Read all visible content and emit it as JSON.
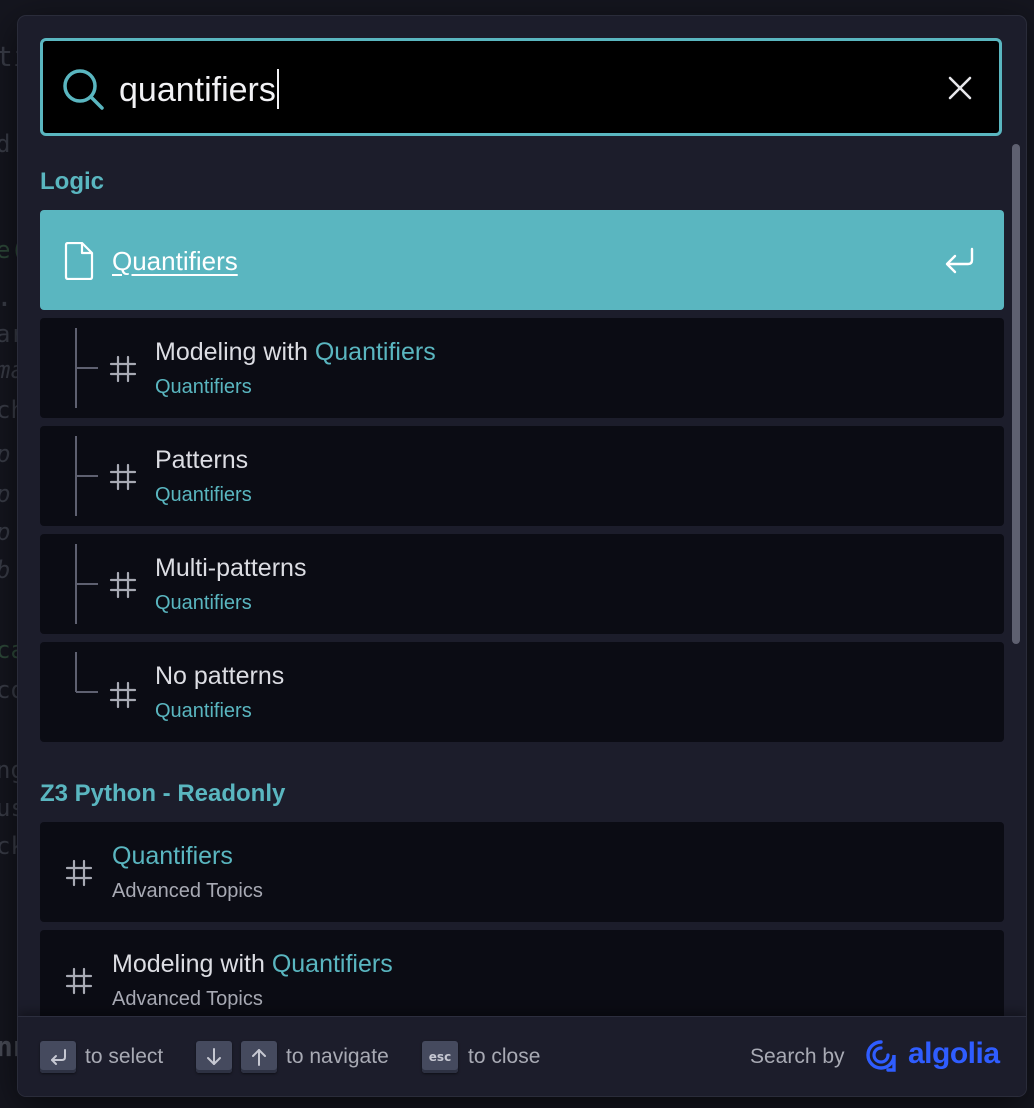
{
  "background": {
    "fragments": [
      "ti",
      "d",
      "e(",
      "..",
      "ar",
      "ma",
      "ch",
      "p",
      "p",
      "p",
      "b",
      "ca",
      "co",
      "ng",
      "us",
      "ck",
      "nn"
    ]
  },
  "search": {
    "query": "quantifiers",
    "clear_icon": "close-icon"
  },
  "sections": [
    {
      "title": "Logic",
      "hits": [
        {
          "title": "Quantifiers",
          "selected": true,
          "icon": "document-icon"
        },
        {
          "title_prefix": "Modeling with ",
          "title_highlight": "Quantifiers",
          "subtitle": "Quantifiers"
        },
        {
          "title_prefix": "Patterns",
          "title_highlight": "",
          "subtitle": "Quantifiers"
        },
        {
          "title_prefix": "Multi-patterns",
          "title_highlight": "",
          "subtitle": "Quantifiers"
        },
        {
          "title_prefix": "No patterns",
          "title_highlight": "",
          "subtitle": "Quantifiers"
        }
      ]
    },
    {
      "title": "Z3 Python - Readonly",
      "hits": [
        {
          "title_prefix": "",
          "title_highlight": "Quantifiers",
          "subtitle": "Advanced Topics"
        },
        {
          "title_prefix": "Modeling with ",
          "title_highlight": "Quantifiers",
          "subtitle": "Advanced Topics"
        }
      ]
    }
  ],
  "footer": {
    "select_label": "to select",
    "navigate_label": "to navigate",
    "close_key": "esc",
    "close_label": "to close",
    "search_by": "Search by",
    "brand": "algolia"
  },
  "colors": {
    "accent": "#5ab6c0",
    "algolia": "#2f5dff",
    "modal_bg": "#1c1d2b",
    "hit_bg": "#0b0c14"
  }
}
